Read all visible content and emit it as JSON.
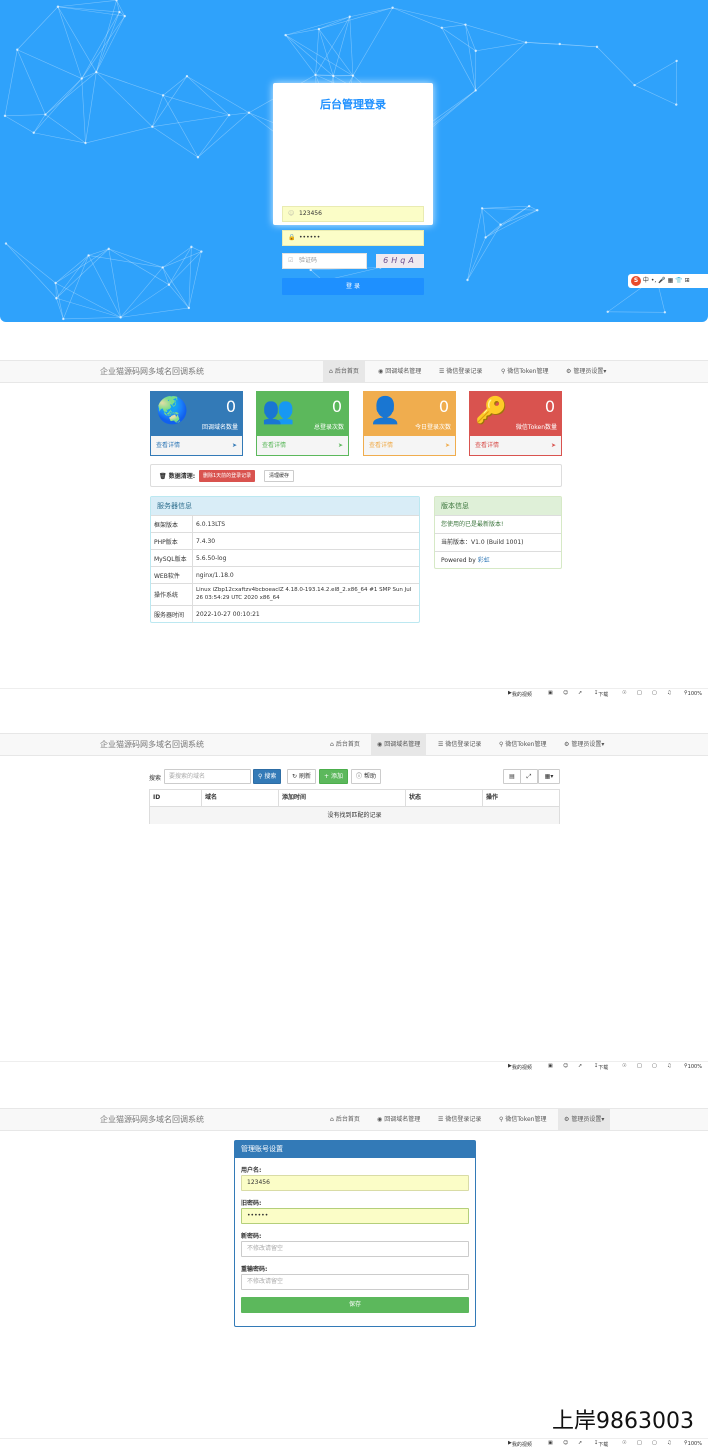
{
  "login": {
    "title": "后台管理登录",
    "username_value": "123456",
    "password_value": "••••••",
    "captcha_placeholder": "验证码",
    "captcha_text": "6HqA",
    "submit_label": "登 录",
    "ime_items": [
      "中",
      "•,",
      "🎤",
      "▦",
      "👕",
      "⊞"
    ],
    "ime_logo": "S"
  },
  "nav": {
    "brand": "企业猫源码网多域名回调系统",
    "items": [
      "后台首页",
      "回调域名管理",
      "微信登录记录",
      "微信Token管理",
      "管理员设置"
    ]
  },
  "dashboard": {
    "stats": [
      {
        "value": "0",
        "label": "回调域名数量",
        "link": "查看详情",
        "color": "#337ab7"
      },
      {
        "value": "0",
        "label": "总登录次数",
        "link": "查看详情",
        "color": "#5cb85c"
      },
      {
        "value": "0",
        "label": "今日登录次数",
        "link": "查看详情",
        "color": "#f0ad4e"
      },
      {
        "value": "0",
        "label": "微信Token数量",
        "link": "查看详情",
        "color": "#d9534f"
      }
    ],
    "cleanup": {
      "label": "数据清理:",
      "delete_btn": "删除1天前的登录记录",
      "cache_btn": "清理缓存"
    },
    "server": {
      "title": "服务器信息",
      "rows": [
        {
          "k": "框架版本",
          "v": "6.0.13LTS"
        },
        {
          "k": "PHP版本",
          "v": "7.4.30"
        },
        {
          "k": "MySQL版本",
          "v": "5.6.50-log"
        },
        {
          "k": "WEB软件",
          "v": "nginx/1.18.0"
        },
        {
          "k": "操作系统",
          "v": "Linux iZbp12cxaftzv4bcboeacIZ 4.18.0-193.14.2.el8_2.x86_64 #1 SMP Sun Jul 26 03:54:29 UTC 2020 x86_64"
        },
        {
          "k": "服务器时间",
          "v": "2022-10-27 00:10:21"
        }
      ]
    },
    "version": {
      "title": "版本信息",
      "latest": "您使用的已是最新版本!",
      "current": "当前版本：V1.0 (Build 1001)",
      "powered_prefix": "Powered by",
      "powered_link": "彩虹"
    }
  },
  "status_bar": {
    "items": [
      "我的视频",
      "下载",
      "100%"
    ]
  },
  "domains": {
    "search_label": "搜索",
    "search_placeholder": "要搜索的域名",
    "search_btn": "搜索",
    "refresh_btn": "刷新",
    "add_btn": "添加",
    "help_btn": "帮助",
    "columns": [
      "ID",
      "域名",
      "添加时间",
      "状态",
      "操作"
    ],
    "empty": "没有找到匹配的记录"
  },
  "account": {
    "title": "管理账号设置",
    "username_label": "用户名:",
    "username_value": "123456",
    "old_pw_label": "旧密码:",
    "old_pw_value": "••••••",
    "new_pw_label": "新密码:",
    "new_pw_placeholder": "不修改请留空",
    "confirm_label": "重输密码:",
    "confirm_placeholder": "不修改请留空",
    "save_btn": "保存"
  },
  "watermark": "上岸9863003"
}
